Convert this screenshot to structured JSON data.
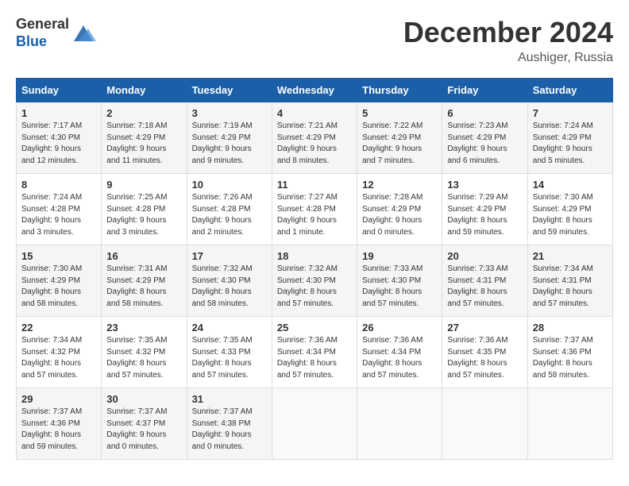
{
  "header": {
    "logo_general": "General",
    "logo_blue": "Blue",
    "month_title": "December 2024",
    "location": "Aushiger, Russia"
  },
  "weekdays": [
    "Sunday",
    "Monday",
    "Tuesday",
    "Wednesday",
    "Thursday",
    "Friday",
    "Saturday"
  ],
  "weeks": [
    [
      {
        "day": "1",
        "info": "Sunrise: 7:17 AM\nSunset: 4:30 PM\nDaylight: 9 hours and 12 minutes."
      },
      {
        "day": "2",
        "info": "Sunrise: 7:18 AM\nSunset: 4:29 PM\nDaylight: 9 hours and 11 minutes."
      },
      {
        "day": "3",
        "info": "Sunrise: 7:19 AM\nSunset: 4:29 PM\nDaylight: 9 hours and 9 minutes."
      },
      {
        "day": "4",
        "info": "Sunrise: 7:21 AM\nSunset: 4:29 PM\nDaylight: 9 hours and 8 minutes."
      },
      {
        "day": "5",
        "info": "Sunrise: 7:22 AM\nSunset: 4:29 PM\nDaylight: 9 hours and 7 minutes."
      },
      {
        "day": "6",
        "info": "Sunrise: 7:23 AM\nSunset: 4:29 PM\nDaylight: 9 hours and 6 minutes."
      },
      {
        "day": "7",
        "info": "Sunrise: 7:24 AM\nSunset: 4:29 PM\nDaylight: 9 hours and 5 minutes."
      }
    ],
    [
      {
        "day": "8",
        "info": "Sunrise: 7:24 AM\nSunset: 4:28 PM\nDaylight: 9 hours and 3 minutes."
      },
      {
        "day": "9",
        "info": "Sunrise: 7:25 AM\nSunset: 4:28 PM\nDaylight: 9 hours and 3 minutes."
      },
      {
        "day": "10",
        "info": "Sunrise: 7:26 AM\nSunset: 4:28 PM\nDaylight: 9 hours and 2 minutes."
      },
      {
        "day": "11",
        "info": "Sunrise: 7:27 AM\nSunset: 4:28 PM\nDaylight: 9 hours and 1 minute."
      },
      {
        "day": "12",
        "info": "Sunrise: 7:28 AM\nSunset: 4:29 PM\nDaylight: 9 hours and 0 minutes."
      },
      {
        "day": "13",
        "info": "Sunrise: 7:29 AM\nSunset: 4:29 PM\nDaylight: 8 hours and 59 minutes."
      },
      {
        "day": "14",
        "info": "Sunrise: 7:30 AM\nSunset: 4:29 PM\nDaylight: 8 hours and 59 minutes."
      }
    ],
    [
      {
        "day": "15",
        "info": "Sunrise: 7:30 AM\nSunset: 4:29 PM\nDaylight: 8 hours and 58 minutes."
      },
      {
        "day": "16",
        "info": "Sunrise: 7:31 AM\nSunset: 4:29 PM\nDaylight: 8 hours and 58 minutes."
      },
      {
        "day": "17",
        "info": "Sunrise: 7:32 AM\nSunset: 4:30 PM\nDaylight: 8 hours and 58 minutes."
      },
      {
        "day": "18",
        "info": "Sunrise: 7:32 AM\nSunset: 4:30 PM\nDaylight: 8 hours and 57 minutes."
      },
      {
        "day": "19",
        "info": "Sunrise: 7:33 AM\nSunset: 4:30 PM\nDaylight: 8 hours and 57 minutes."
      },
      {
        "day": "20",
        "info": "Sunrise: 7:33 AM\nSunset: 4:31 PM\nDaylight: 8 hours and 57 minutes."
      },
      {
        "day": "21",
        "info": "Sunrise: 7:34 AM\nSunset: 4:31 PM\nDaylight: 8 hours and 57 minutes."
      }
    ],
    [
      {
        "day": "22",
        "info": "Sunrise: 7:34 AM\nSunset: 4:32 PM\nDaylight: 8 hours and 57 minutes."
      },
      {
        "day": "23",
        "info": "Sunrise: 7:35 AM\nSunset: 4:32 PM\nDaylight: 8 hours and 57 minutes."
      },
      {
        "day": "24",
        "info": "Sunrise: 7:35 AM\nSunset: 4:33 PM\nDaylight: 8 hours and 57 minutes."
      },
      {
        "day": "25",
        "info": "Sunrise: 7:36 AM\nSunset: 4:34 PM\nDaylight: 8 hours and 57 minutes."
      },
      {
        "day": "26",
        "info": "Sunrise: 7:36 AM\nSunset: 4:34 PM\nDaylight: 8 hours and 57 minutes."
      },
      {
        "day": "27",
        "info": "Sunrise: 7:36 AM\nSunset: 4:35 PM\nDaylight: 8 hours and 57 minutes."
      },
      {
        "day": "28",
        "info": "Sunrise: 7:37 AM\nSunset: 4:36 PM\nDaylight: 8 hours and 58 minutes."
      }
    ],
    [
      {
        "day": "29",
        "info": "Sunrise: 7:37 AM\nSunset: 4:36 PM\nDaylight: 8 hours and 59 minutes."
      },
      {
        "day": "30",
        "info": "Sunrise: 7:37 AM\nSunset: 4:37 PM\nDaylight: 9 hours and 0 minutes."
      },
      {
        "day": "31",
        "info": "Sunrise: 7:37 AM\nSunset: 4:38 PM\nDaylight: 9 hours and 0 minutes."
      },
      null,
      null,
      null,
      null
    ]
  ]
}
